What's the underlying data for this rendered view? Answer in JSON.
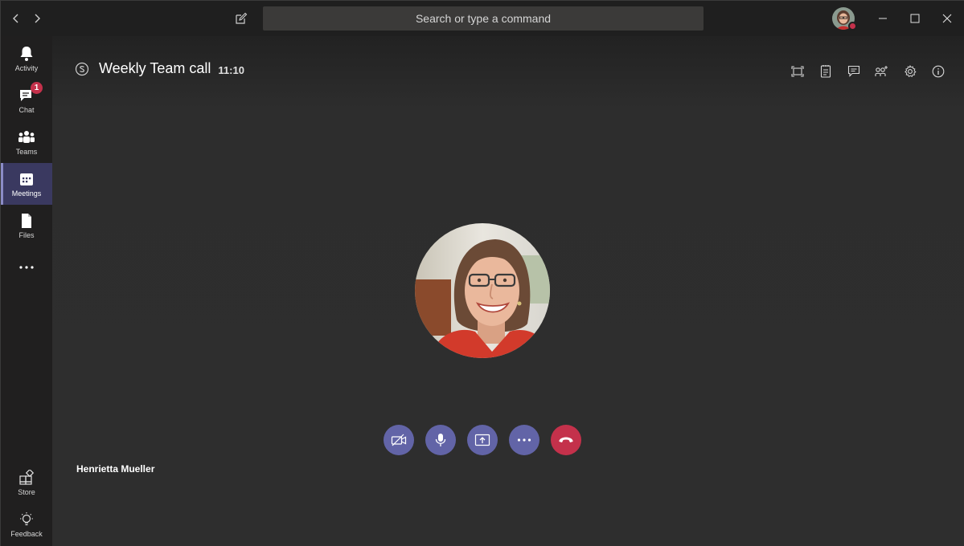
{
  "titlebar": {
    "back_icon": "chevron-left-icon",
    "forward_icon": "chevron-right-icon",
    "compose_icon": "compose-icon",
    "search_placeholder": "Search or type a command",
    "window_controls": [
      "minimize-icon",
      "maximize-icon",
      "close-icon"
    ],
    "presence_color": "#c4314b"
  },
  "rail": {
    "items": [
      {
        "label": "Activity",
        "icon": "bell-icon"
      },
      {
        "label": "Chat",
        "icon": "chat-icon",
        "badge": "1"
      },
      {
        "label": "Teams",
        "icon": "teams-icon"
      },
      {
        "label": "Meetings",
        "icon": "calendar-icon",
        "active": true
      },
      {
        "label": "Files",
        "icon": "file-icon"
      },
      {
        "label": "",
        "icon": "more-icon"
      }
    ],
    "bottom": [
      {
        "label": "Store",
        "icon": "store-icon"
      },
      {
        "label": "Feedback",
        "icon": "lightbulb-icon"
      }
    ],
    "accent": "#6264a7"
  },
  "meeting": {
    "title": "Weekly Team call",
    "time": "11:10",
    "participant_name": "Henrietta Mueller",
    "top_tools": [
      "fullscreen-icon",
      "meeting-notes-icon",
      "chat-icon",
      "participants-icon",
      "settings-icon",
      "info-icon"
    ],
    "controls": [
      {
        "name": "camera-off",
        "icon": "video-off-icon"
      },
      {
        "name": "microphone",
        "icon": "microphone-icon"
      },
      {
        "name": "share-screen",
        "icon": "share-screen-icon"
      },
      {
        "name": "more-actions",
        "icon": "more-icon"
      },
      {
        "name": "hang-up",
        "icon": "hang-up-icon",
        "color": "#c4314b"
      }
    ],
    "control_color": "#6264a7"
  }
}
